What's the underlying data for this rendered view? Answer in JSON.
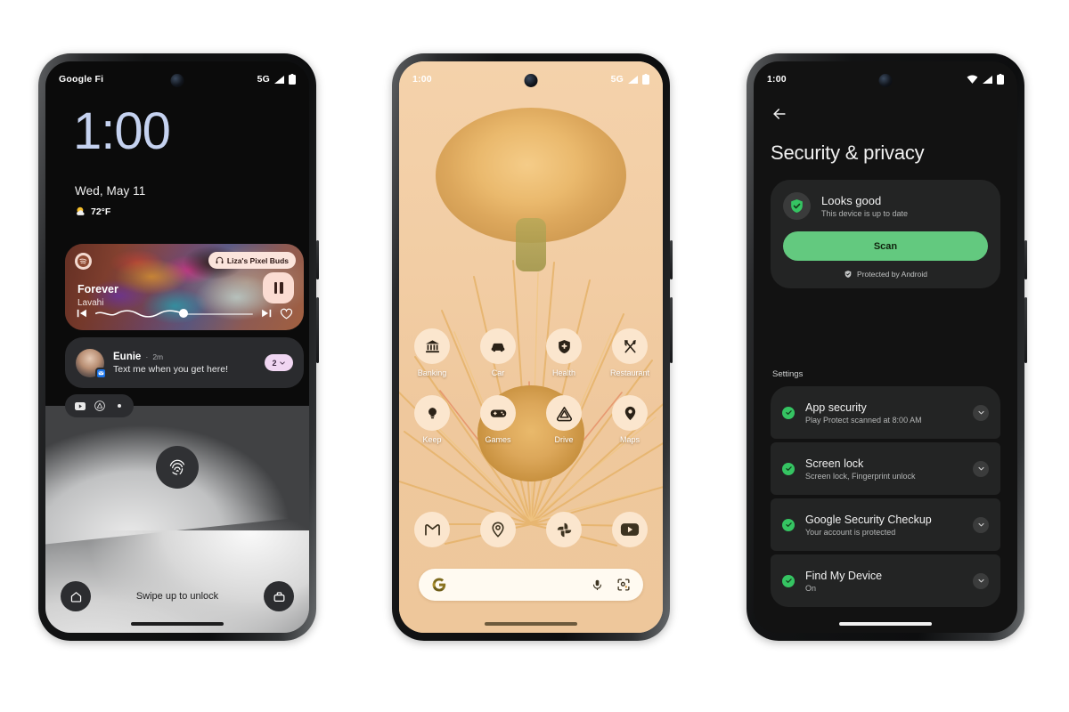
{
  "phone1": {
    "name": "pixel-lockscreen",
    "status": {
      "carrier": "Google Fi",
      "network": "5G",
      "signal_icon": "signal-bars-icon",
      "battery_icon": "battery-full-icon"
    },
    "clock": "1:00",
    "date": "Wed, May 11",
    "weather": {
      "icon": "partly-cloudy-sun-icon",
      "temp": "72°F"
    },
    "media": {
      "app_icon": "spotify-icon",
      "output_chip": {
        "icon": "headphones-icon",
        "label": "Liza's Pixel Buds"
      },
      "title": "Forever",
      "artist": "Lavahi",
      "prev_icon": "skip-previous-icon",
      "next_icon": "skip-next-icon",
      "play_state_icon": "pause-icon",
      "favorite_icon": "heart-outline-icon",
      "progress_percent": 53
    },
    "notification": {
      "sender": "Eunie",
      "separator": "·",
      "time": "2m",
      "message": "Text me when you get here!",
      "app_badge_icon": "messages-icon",
      "group_count": "2",
      "expand_icon": "chevron-down-icon"
    },
    "mini_icons": [
      "youtube-icon",
      "drive-icon",
      "more-dot-icon"
    ],
    "fingerprint_icon": "fingerprint-icon",
    "bottom": {
      "left_icon": "home-shortcut-icon",
      "hint": "Swipe up to unlock",
      "right_icon": "wallet-icon"
    }
  },
  "phone2": {
    "name": "pixel-homescreen",
    "status": {
      "time": "1:00",
      "network": "5G",
      "signal_icon": "signal-bars-icon",
      "battery_icon": "battery-full-icon"
    },
    "apps_row1": [
      {
        "label": "Banking",
        "icon": "bank-icon"
      },
      {
        "label": "Car",
        "icon": "car-icon"
      },
      {
        "label": "Health",
        "icon": "health-shield-icon"
      },
      {
        "label": "Restaurant",
        "icon": "restaurant-icon"
      }
    ],
    "apps_row2": [
      {
        "label": "Keep",
        "icon": "keep-bulb-icon"
      },
      {
        "label": "Games",
        "icon": "gamepad-icon"
      },
      {
        "label": "Drive",
        "icon": "drive-icon"
      },
      {
        "label": "Maps",
        "icon": "maps-pin-icon"
      }
    ],
    "dock": [
      {
        "label": "Gmail",
        "icon": "gmail-icon"
      },
      {
        "label": "Maps",
        "icon": "maps-pin-icon"
      },
      {
        "label": "Photos",
        "icon": "photos-icon"
      },
      {
        "label": "YouTube",
        "icon": "youtube-icon"
      }
    ],
    "search": {
      "logo": "google-g-icon",
      "placeholder": "",
      "value": "",
      "mic_icon": "microphone-icon",
      "lens_icon": "google-lens-icon"
    }
  },
  "phone3": {
    "name": "security-privacy-settings",
    "status": {
      "time": "1:00",
      "wifi_icon": "wifi-icon",
      "signal_icon": "signal-bars-icon",
      "battery_icon": "battery-full-icon"
    },
    "back_icon": "arrow-back-icon",
    "title": "Security & privacy",
    "status_card": {
      "icon": "shield-check-icon",
      "title": "Looks good",
      "subtitle": "This device is up to date",
      "button_label": "Scan",
      "footer_icon": "shield-small-icon",
      "footer_label": "Protected by Android"
    },
    "section_label": "Settings",
    "items": [
      {
        "icon": "check-circle-icon",
        "title": "App security",
        "subtitle": "Play Protect scanned at 8:00 AM",
        "expand_icon": "chevron-down-icon"
      },
      {
        "icon": "check-circle-icon",
        "title": "Screen lock",
        "subtitle": "Screen lock, Fingerprint unlock",
        "expand_icon": "chevron-down-icon"
      },
      {
        "icon": "check-circle-icon",
        "title": "Google Security Checkup",
        "subtitle": "Your account is protected",
        "expand_icon": "chevron-down-icon"
      },
      {
        "icon": "check-circle-icon",
        "title": "Find My Device",
        "subtitle": "On",
        "expand_icon": "chevron-down-icon"
      }
    ]
  },
  "colors": {
    "accent_green": "#63c97f",
    "check_green": "#35c462",
    "clock_blue": "#c5d2f0",
    "chip_pink": "#f0d6f2",
    "wallpaper_peach": "#f2cfa8",
    "app_icon_cream": "#fbe6ce"
  }
}
